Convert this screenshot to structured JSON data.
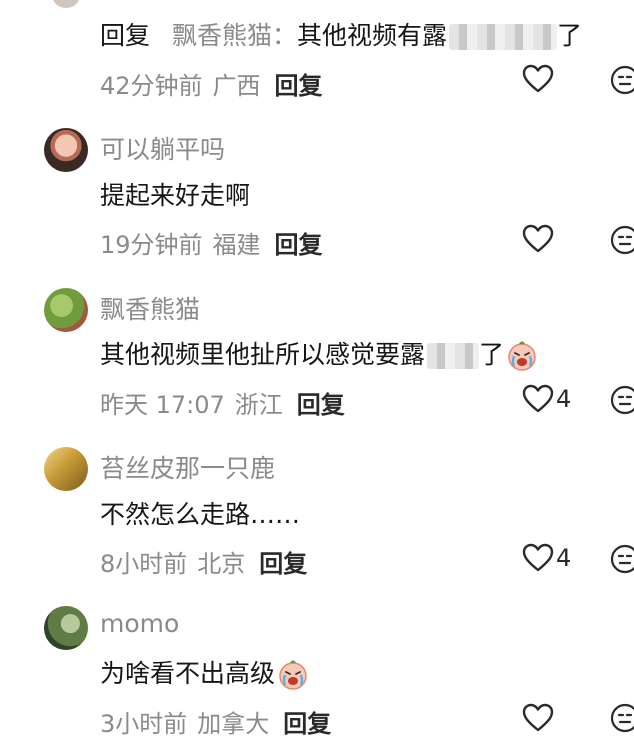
{
  "comments": [
    {
      "reply_label": "回复",
      "reply_to": "飘香熊猫：",
      "text": "其他视频有露",
      "trail": "了",
      "time": "42分钟前",
      "location": "广西",
      "reply": "回复",
      "likes": ""
    },
    {
      "username": "可以躺平吗",
      "text": "提起来好走啊",
      "time": "19分钟前",
      "location": "福建",
      "reply": "回复",
      "likes": ""
    },
    {
      "username": "飘香熊猫",
      "text": "其他视频里他扯所以感觉要露",
      "trail": "了",
      "emoji": "crying-face-emoji",
      "time": "昨天 17:07",
      "location": "浙江",
      "reply": "回复",
      "likes": "4"
    },
    {
      "username": "苔丝皮那一只鹿",
      "text": "不然怎么走路……",
      "time": "8小时前",
      "location": "北京",
      "reply": "回复",
      "likes": "4"
    },
    {
      "username": "momo",
      "text": "为啥看不出高级",
      "emoji": "crying-face-emoji",
      "time": "3小时前",
      "location": "加拿大",
      "reply": "回复",
      "likes": ""
    }
  ],
  "icons": {
    "like": "heart-outline-icon",
    "dislike": "neutral-face-icon"
  },
  "colors": {
    "muted_text": "#8a8a8a",
    "primary_text": "#161616"
  }
}
